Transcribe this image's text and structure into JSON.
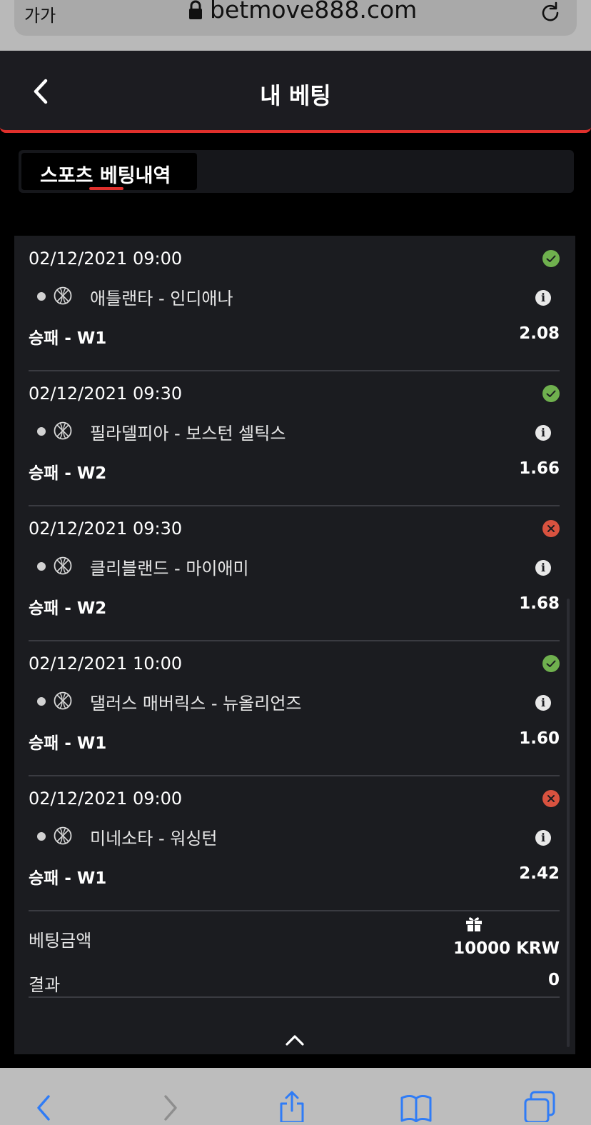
{
  "browser": {
    "text_size_label": "가가",
    "url": "betmove888.com"
  },
  "header": {
    "title": "내 베팅"
  },
  "tabs": [
    {
      "label": "스포츠 베팅내역",
      "active": true
    }
  ],
  "bets": [
    {
      "datetime": "02/12/2021 09:00",
      "status": "win",
      "sport_icon": "basketball-icon",
      "match": "애틀랜타 - 인디애나",
      "market": "승패 - W1",
      "odds": "2.08"
    },
    {
      "datetime": "02/12/2021 09:30",
      "status": "win",
      "sport_icon": "basketball-icon",
      "match": "필라델피아 - 보스턴 셀틱스",
      "market": "승패 - W2",
      "odds": "1.66"
    },
    {
      "datetime": "02/12/2021 09:30",
      "status": "lose",
      "sport_icon": "basketball-icon",
      "match": "클리블랜드 - 마이애미",
      "market": "승패 - W2",
      "odds": "1.68"
    },
    {
      "datetime": "02/12/2021 10:00",
      "status": "win",
      "sport_icon": "basketball-icon",
      "match": "댈러스 매버릭스 - 뉴올리언즈",
      "market": "승패 - W1",
      "odds": "1.60"
    },
    {
      "datetime": "02/12/2021 09:00",
      "status": "lose",
      "sport_icon": "basketball-icon",
      "match": "미네소타 - 워싱턴",
      "market": "승패 - W1",
      "odds": "2.42"
    }
  ],
  "summary": {
    "stake_label": "베팅금액",
    "stake_value": "10000 KRW",
    "result_label": "결과",
    "result_value": "0"
  },
  "colors": {
    "accent": "#e0302c",
    "win": "#6fb04e",
    "lose": "#d8523f",
    "ios_blue": "#2f7cf6"
  }
}
